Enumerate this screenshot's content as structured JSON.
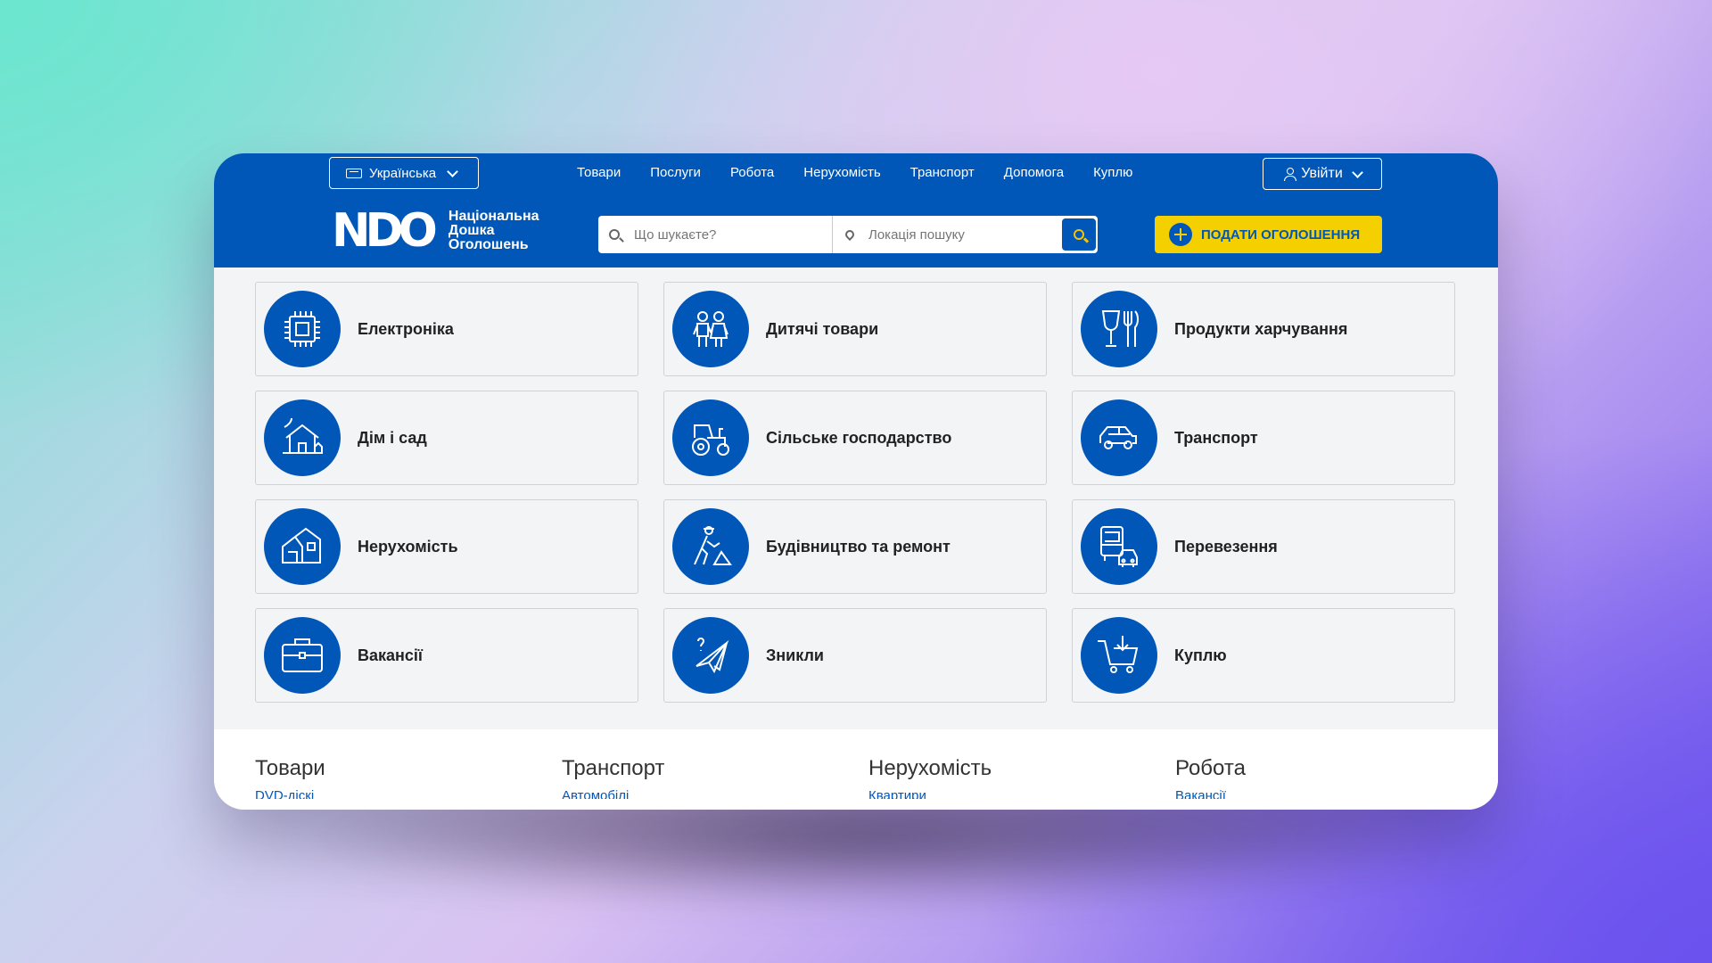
{
  "header": {
    "language_label": "Українська",
    "nav": [
      "Товари",
      "Послуги",
      "Робота",
      "Нерухомість",
      "Транспорт",
      "Допомога",
      "Куплю"
    ],
    "login_label": "Увійти",
    "logo_mark": "NDO",
    "logo_lines": [
      "Національна",
      "Дошка",
      "Оголошень"
    ],
    "search_placeholder": "Що шукаєте?",
    "location_placeholder": "Локація пошуку",
    "post_label": "ПОДАТИ ОГОЛОШЕННЯ"
  },
  "categories": [
    {
      "label": "Електроніка",
      "icon": "chip-icon"
    },
    {
      "label": "Дитячі товари",
      "icon": "children-icon"
    },
    {
      "label": "Продукти харчування",
      "icon": "food-icon"
    },
    {
      "label": "Дім і сад",
      "icon": "house-garden-icon"
    },
    {
      "label": "Сільське господарство",
      "icon": "tractor-icon"
    },
    {
      "label": "Транспорт",
      "icon": "car-icon"
    },
    {
      "label": "Нерухомість",
      "icon": "real-estate-icon"
    },
    {
      "label": "Будівництво та ремонт",
      "icon": "construction-icon"
    },
    {
      "label": "Перевезення",
      "icon": "bus-car-icon"
    },
    {
      "label": "Вакансії",
      "icon": "briefcase-icon"
    },
    {
      "label": "Зникли",
      "icon": "lost-plane-icon"
    },
    {
      "label": "Куплю",
      "icon": "cart-icon"
    }
  ],
  "footer": {
    "columns": [
      {
        "title": "Товари",
        "link": "DVD-дiскi"
      },
      {
        "title": "Транспорт",
        "link": "Автомобілі"
      },
      {
        "title": "Нерухомість",
        "link": "Квартири"
      },
      {
        "title": "Робота",
        "link": "Вакансії"
      }
    ]
  },
  "colors": {
    "brand_blue": "#0057b8",
    "accent_yellow": "#f5d000"
  }
}
